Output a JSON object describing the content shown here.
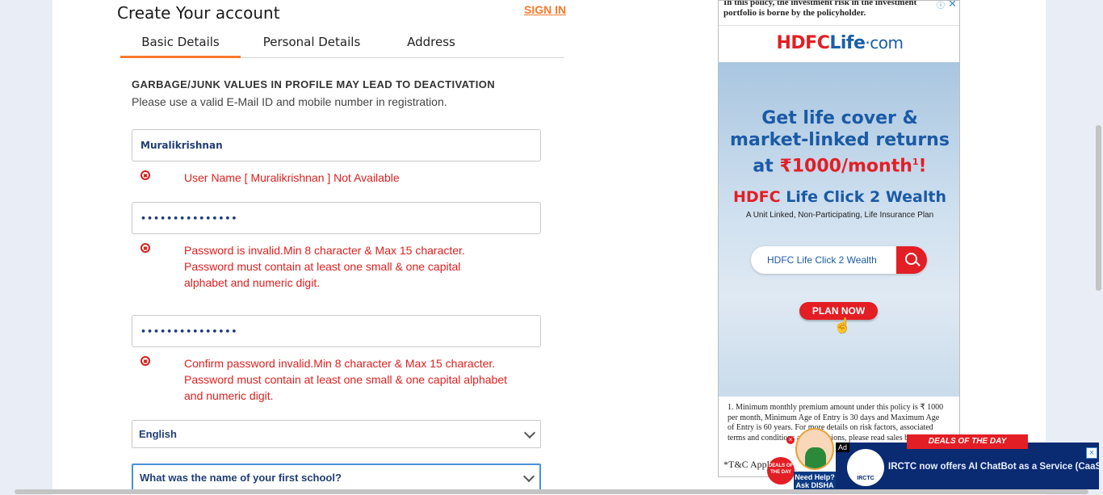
{
  "form": {
    "title": "Create Your account",
    "signin_label": "SIGN IN",
    "tabs": [
      {
        "label": "Basic Details",
        "active": true
      },
      {
        "label": "Personal Details",
        "active": false
      },
      {
        "label": "Address",
        "active": false
      }
    ],
    "warning": "GARBAGE/JUNK VALUES IN PROFILE MAY LEAD TO DEACTIVATION",
    "note": "Please use a valid E-Mail ID and mobile number in registration.",
    "username_value": "Muralikrishnan",
    "username_error": "User Name [ Muralikrishnan ] Not Available",
    "password_value": "•••••••••••••••",
    "password_error": "Password is invalid.Min 8 character & Max 15 character. Password must contain at least one small & one capital alphabet and numeric digit.",
    "confirm_value": "•••••••••••••••",
    "confirm_error": "Confirm password invalid.Min 8 character & Max 15 character. Password must contain at least one small & one capital alphabet and numeric digit.",
    "language_selected": "English",
    "security_question_selected": "What was the name of your first school?"
  },
  "ad": {
    "top_text": "In this policy, the investment risk in the investment portfolio is borne by the policyholder.",
    "logo_hdfc": "HDFC",
    "logo_life": "Life",
    "logo_com": "·com",
    "headline_line1": "Get life cover &",
    "headline_line2": "market-linked returns",
    "headline_line3_prefix": "at ",
    "headline_line3_amount": "₹1000/month",
    "headline_sup": "1",
    "headline_suffix": "!",
    "product_part1": "HDFC ",
    "product_part2": "Life Click 2 Wealth",
    "product_sub": "A Unit Linked, Non-Participating, Life Insurance Plan",
    "search_text": "HDFC Life Click 2 Wealth",
    "plan_now": "PLAN NOW",
    "disclaimer": "1. Minimum monthly premium amount under this policy is ₹ 1000 per month, Minimum Age of Entry is 30 days and Maximum Age of Entry is 60 years. For more details on risk factors, associated terms and conditions and exclusions, please read sales brochure",
    "tc": "*T&C Apply"
  },
  "disha": {
    "deal": "DEALS OF THE DAY",
    "help": "Need Help?",
    "ask": "Ask DISHA"
  },
  "irctc_ad": {
    "ad_label": "Ad",
    "deal_banner": "DEALS OF THE DAY",
    "logo": "IRCTC",
    "text": "IRCTC now offers AI ChatBot as a Service (CaaS)"
  }
}
